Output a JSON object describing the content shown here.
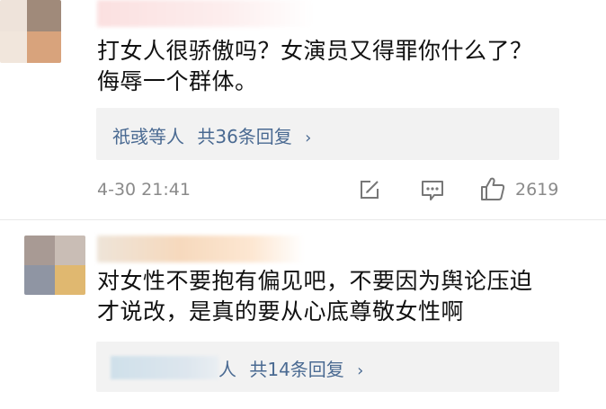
{
  "comments": [
    {
      "text_line1": "打女人很骄傲吗？女演员又得罪你什么了？",
      "text_line2": "侮辱一个群体。",
      "reply_summary": {
        "users": "祇彧等人",
        "count_label": "共36条回复",
        "chevron": "›"
      },
      "timestamp": "4-30 21:41",
      "likes": "2619",
      "icons": [
        "edit-icon",
        "comment-icon",
        "like-icon"
      ]
    },
    {
      "text_line1": "对女性不要抱有偏见吧，不要因为舆论压迫",
      "text_line2": "才说改，是真的要从心底尊敬女性啊",
      "reply_summary": {
        "users": "人",
        "count_label": "共14条回复",
        "chevron": "›"
      }
    }
  ],
  "colors": {
    "link": "#4a6a92",
    "meta": "#8a8a8a",
    "reply_bg": "#f2f2f2"
  }
}
